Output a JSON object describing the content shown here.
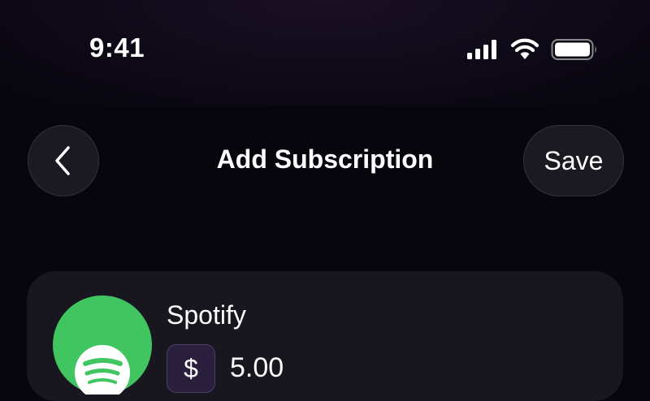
{
  "status_bar": {
    "time": "9:41",
    "icons": [
      "signal-icon",
      "wifi-icon",
      "battery-icon"
    ]
  },
  "header": {
    "back_icon": "chevron-left-icon",
    "title": "Add Subscription",
    "save_label": "Save"
  },
  "subscription": {
    "name": "Spotify",
    "logo_icon": "spotify-logo-icon",
    "currency_symbol": "$",
    "price": "5.00"
  },
  "colors": {
    "background": "#07060d",
    "button_bg": "#1b1a22",
    "card_bg": "#18171f",
    "spotify_green": "#40c561",
    "currency_box_bg": "#2a1f3d"
  }
}
